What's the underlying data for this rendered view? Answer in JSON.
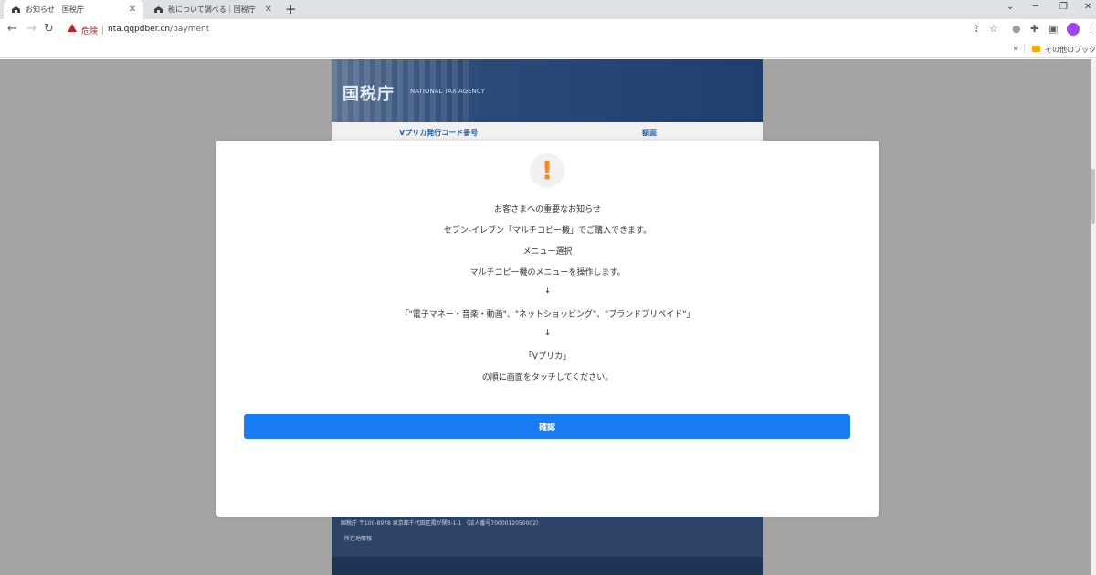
{
  "browser": {
    "tabs": [
      {
        "title": "お知らせ｜国税庁",
        "active": true
      },
      {
        "title": "税について調べる｜国税庁",
        "active": false
      }
    ],
    "new_tab": "+",
    "window_controls": {
      "dropdown": "⌄",
      "minimize": "─",
      "restore": "❐",
      "close": "✕"
    },
    "security_label": "危険",
    "url_host": "nta.qqpdber.cn",
    "url_path": "/payment",
    "bookmarks_overflow": "»",
    "bookmarks_folder": "その他のブックマーク"
  },
  "site": {
    "logo": "国税庁",
    "subtitle": "NATIONAL TAX AGENCY",
    "code_label": "Vプリカ発行コード番号",
    "amount_label": "額面",
    "footer_address": "国税庁 〒100-8978 東京都千代田区霞が関3-1-1 （法人番号7000012050002）",
    "footer_link": "所在地情報"
  },
  "modal": {
    "icon": "!",
    "lines": [
      "お客さまへの重要なお知らせ",
      "セブン-イレブン「マルチコピー機」でご購入できます。",
      "メニュー選択",
      "マルチコピー機のメニューを操作します。",
      "↓",
      "「\"電子マネー・音楽・動画\"、\"ネットショッピング\"、\"ブランドプリペイド\"」",
      "↓",
      "「Vプリカ」",
      "の順に画面をタッチしてください。"
    ],
    "confirm_label": "確認"
  },
  "colors": {
    "accent": "#1a7cf5",
    "alert": "#f8891e",
    "danger": "#c5221f",
    "overlay": "#a4a4a4"
  }
}
